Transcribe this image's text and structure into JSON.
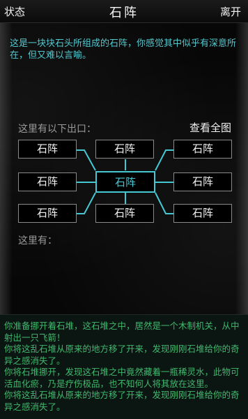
{
  "header": {
    "status_label": "状态",
    "title": "石阵",
    "leave_label": "离开"
  },
  "room": {
    "description": "这是一块块石头所组成的石阵，你感觉其中似乎有深意所在，但又难以言喻。",
    "exits_label": "这里有以下出口：",
    "view_map_label": "查看全图",
    "here_label": "这里有：",
    "exits": {
      "nw": "石阵",
      "n": "石阵",
      "ne": "石阵",
      "w": "石阵",
      "center": "石阵",
      "e": "石阵",
      "sw": "石阵",
      "s": "石阵",
      "se": "石阵"
    }
  },
  "log": [
    "你准备挪开着石堆，这石堆之中，居然是一个木制机关，从中射出一只飞箭！",
    "你将这乱石堆从原来的地方移了开来，发现刚刚石堆给你的奇异之感消失了。",
    "你将石堆挪开，发现这石堆之中竟然藏着一瓶稀灵水，此物可活血化瘀，乃是疗伤极品，也不知何人将其放在这里。",
    "你将这乱石堆从原来的地方移了开来，发现刚刚石堆给你的奇异之感消失了。"
  ],
  "colors": {
    "accent": "#45c8d2",
    "description": "#53c8cf",
    "log": "#41b96e"
  }
}
